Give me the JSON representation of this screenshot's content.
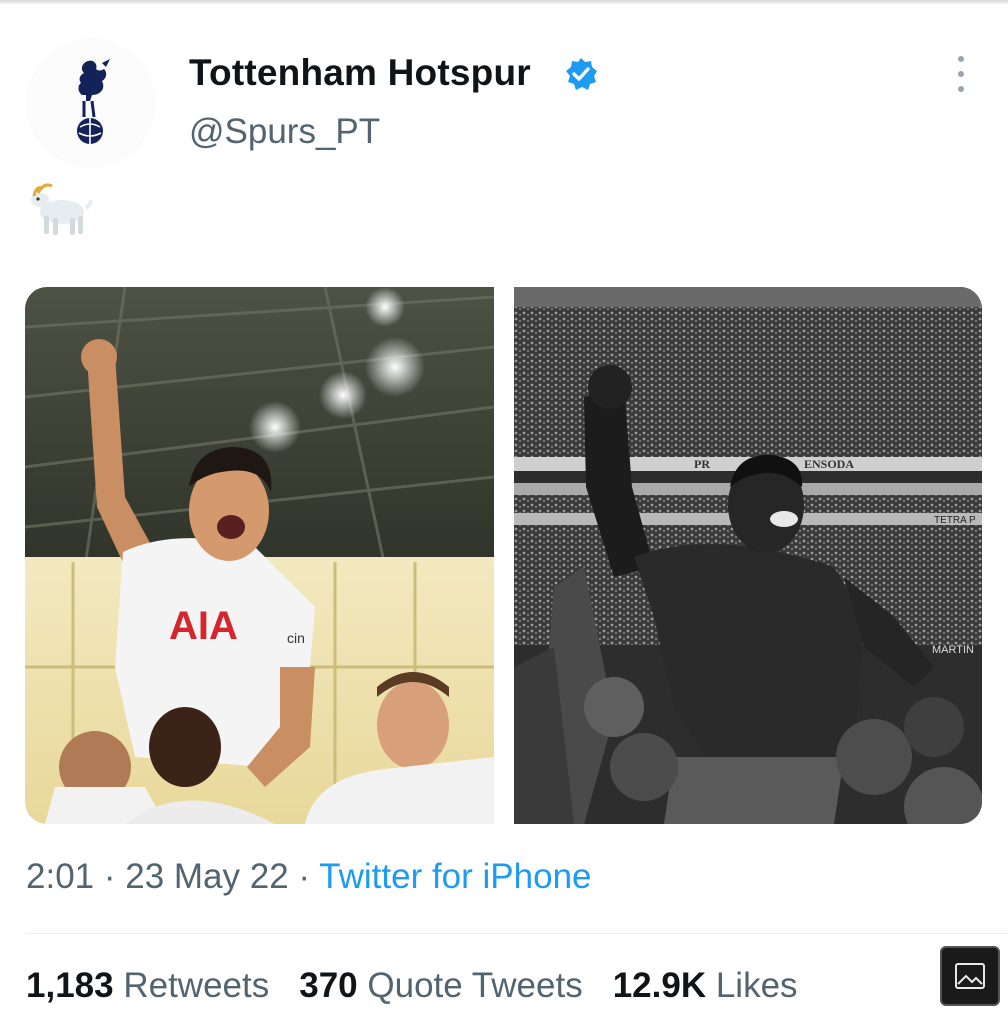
{
  "tweet": {
    "display_name": "Tottenham Hotspur",
    "handle": "@Spurs_PT",
    "text_emoji_name": "goat-emoji",
    "verified": true
  },
  "media": [
    {
      "side": "left",
      "jersey_sponsor": "AIA",
      "sleeve_text": "cin"
    },
    {
      "side": "right",
      "stadium_signs": [
        "PR",
        "ENSODA",
        "TETRA P",
        "MARTIN"
      ]
    }
  ],
  "meta": {
    "time": "2:01",
    "separator": " · ",
    "date": "23 May 22",
    "source": "Twitter for iPhone"
  },
  "stats": {
    "retweets_count": "1,183",
    "retweets_label": "Retweets",
    "quotes_count": "370",
    "quotes_label": "Quote Tweets",
    "likes_count": "12.9K",
    "likes_label": "Likes"
  },
  "icons": {
    "more": "more-vertical-icon",
    "verified": "verified-badge-icon",
    "gallery": "image-gallery-icon"
  },
  "colors": {
    "verified_blue": "#1d9bf0",
    "text_primary": "#0f1419",
    "text_secondary": "#536471",
    "spurs_navy": "#132257"
  }
}
